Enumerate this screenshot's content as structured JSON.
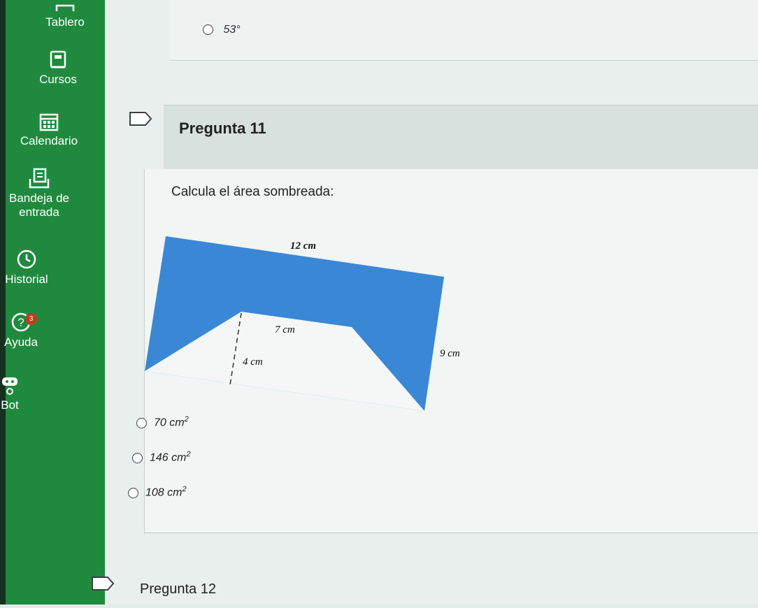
{
  "sidebar": {
    "items": [
      {
        "label": "Tablero",
        "icon": "dashboard-icon"
      },
      {
        "label": "Cursos",
        "icon": "book-icon"
      },
      {
        "label": "Calendario",
        "icon": "calendar-icon"
      },
      {
        "label": "Bandeja de entrada",
        "label_line1": "Bandeja de",
        "label_line2": "entrada",
        "icon": "inbox-icon"
      },
      {
        "label": "Historial",
        "icon": "clock-icon"
      },
      {
        "label": "Ayuda",
        "icon": "help-icon",
        "badge": "3"
      },
      {
        "label": "Bot",
        "icon": "bot-icon"
      }
    ],
    "brand_color": "#1f8a3e"
  },
  "previous_question": {
    "visible_option": "53°"
  },
  "question": {
    "title": "Pregunta 11",
    "prompt": "Calcula el área sombreada:",
    "figure": {
      "top_label": "12 cm",
      "inner_top_label": "7 cm",
      "right_label": "9 cm",
      "height_label": "4 cm",
      "shaded_color": "#3a87d6"
    },
    "options": [
      {
        "value": "70 cm",
        "exp": "2"
      },
      {
        "value": "146 cm",
        "exp": "2"
      },
      {
        "value": "108 cm",
        "exp": "2"
      }
    ]
  },
  "next_question": {
    "title": "Pregunta 12"
  }
}
